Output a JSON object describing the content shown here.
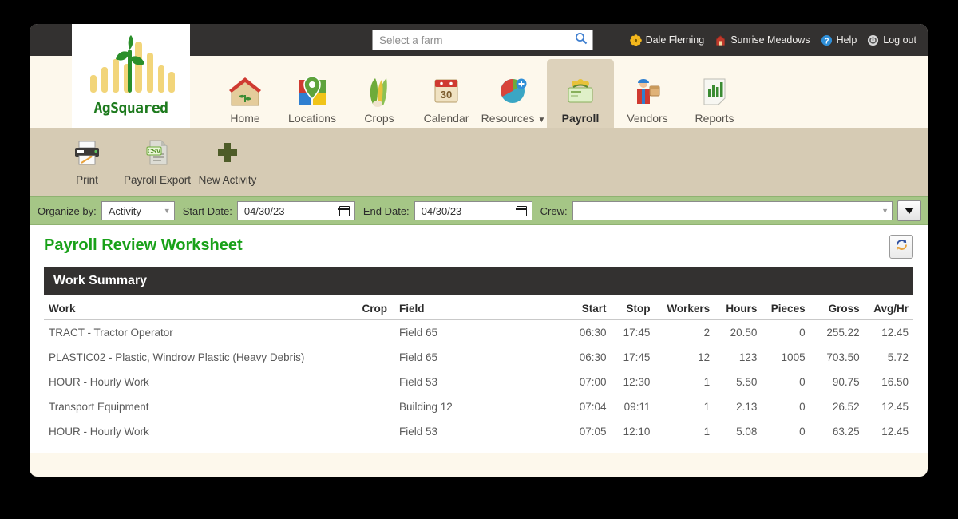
{
  "topbar": {
    "search": {
      "placeholder": "Select a farm",
      "value": ""
    },
    "search_icon": "search-icon",
    "items": [
      {
        "icon": "gear-flower-icon",
        "label": "Dale Fleming"
      },
      {
        "icon": "barn-icon",
        "label": "Sunrise Meadows"
      },
      {
        "icon": "question-circle-icon",
        "label": "Help"
      },
      {
        "icon": "power-icon",
        "label": "Log out"
      }
    ]
  },
  "logo": {
    "name": "AgSquared",
    "icon": "sprout-bars-logo"
  },
  "mainnav": {
    "items": [
      {
        "label": "Home",
        "icon": "house-sprout-icon",
        "active": false,
        "dropdown": false
      },
      {
        "label": "Locations",
        "icon": "map-pin-icon",
        "active": false,
        "dropdown": false
      },
      {
        "label": "Crops",
        "icon": "crops-icon",
        "active": false,
        "dropdown": false
      },
      {
        "label": "Calendar",
        "icon": "calendar-30-icon",
        "active": false,
        "dropdown": false
      },
      {
        "label": "Resources",
        "icon": "pie-chart-plus-icon",
        "active": false,
        "dropdown": true
      },
      {
        "label": "Payroll",
        "icon": "payroll-card-icon",
        "active": true,
        "dropdown": false
      },
      {
        "label": "Vendors",
        "icon": "vendor-worker-icon",
        "active": false,
        "dropdown": false
      },
      {
        "label": "Reports",
        "icon": "bar-chart-icon",
        "active": false,
        "dropdown": false
      }
    ],
    "dropdown_glyph": "▼"
  },
  "toolbar": {
    "items": [
      {
        "label": "Print",
        "icon": "printer-icon"
      },
      {
        "label": "Payroll Export",
        "icon": "csv-file-icon"
      },
      {
        "label": "New Activity",
        "icon": "plus-icon"
      }
    ]
  },
  "filterbar": {
    "organize_label": "Organize by:",
    "organize_value": "Activity",
    "start_label": "Start Date:",
    "start_value": "04/30/23",
    "end_label": "End Date:",
    "end_value": "04/30/23",
    "crew_label": "Crew:",
    "crew_value": "",
    "expand_icon": "chevron-down-icon"
  },
  "content": {
    "page_title": "Payroll Review Worksheet",
    "refresh_icon": "refresh-icon",
    "section_title": "Work Summary"
  },
  "table": {
    "columns": [
      "Work",
      "Crop",
      "Field",
      "Start",
      "Stop",
      "Workers",
      "Hours",
      "Pieces",
      "Gross",
      "Avg/Hr"
    ],
    "rows": [
      {
        "work": "TRACT - Tractor Operator",
        "crop": "",
        "field": "Field 65",
        "start": "06:30",
        "stop": "17:45",
        "workers": "2",
        "hours": "20.50",
        "pieces": "0",
        "gross": "255.22",
        "avghr": "12.45"
      },
      {
        "work": "PLASTIC02 - Plastic, Windrow Plastic (Heavy Debris)",
        "crop": "",
        "field": "Field 65",
        "start": "06:30",
        "stop": "17:45",
        "workers": "12",
        "hours": "123",
        "pieces": "1005",
        "gross": "703.50",
        "avghr": "5.72"
      },
      {
        "work": "HOUR - Hourly Work",
        "crop": "",
        "field": "Field 53",
        "start": "07:00",
        "stop": "12:30",
        "workers": "1",
        "hours": "5.50",
        "pieces": "0",
        "gross": "90.75",
        "avghr": "16.50"
      },
      {
        "work": "Transport Equipment",
        "crop": "",
        "field": "Building 12",
        "start": "07:04",
        "stop": "09:11",
        "workers": "1",
        "hours": "2.13",
        "pieces": "0",
        "gross": "26.52",
        "avghr": "12.45"
      },
      {
        "work": "HOUR - Hourly Work",
        "crop": "",
        "field": "Field 53",
        "start": "07:05",
        "stop": "12:10",
        "workers": "1",
        "hours": "5.08",
        "pieces": "0",
        "gross": "63.25",
        "avghr": "12.45"
      }
    ]
  },
  "colors": {
    "topbar_bg": "#333130",
    "page_bg": "#fdf8ec",
    "toolbar_bg": "#d6cbb4",
    "filterbar_bg": "#a5c686",
    "active_tab_bg": "#ddd2bb",
    "title_green": "#19a119",
    "section_bg": "#333130"
  }
}
